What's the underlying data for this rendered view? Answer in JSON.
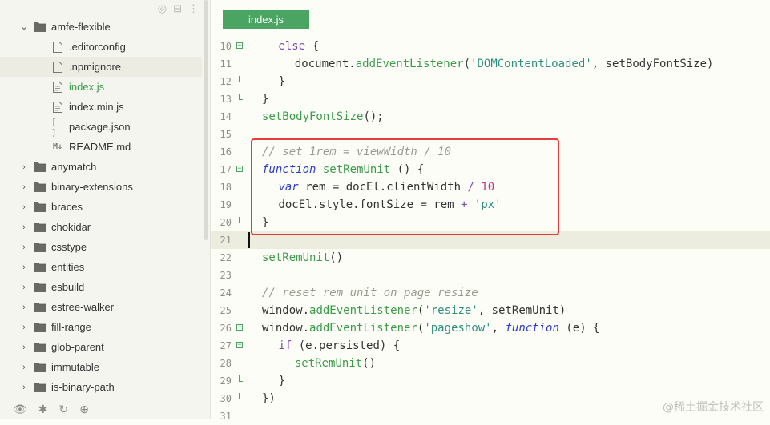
{
  "sidebar": {
    "tree": [
      {
        "type": "folder",
        "open": true,
        "depth": 1,
        "label": "amfe-flexible"
      },
      {
        "type": "file",
        "icon": "file",
        "depth": 2,
        "label": ".editorconfig"
      },
      {
        "type": "file",
        "icon": "file",
        "depth": 2,
        "label": ".npmignore",
        "selected": true
      },
      {
        "type": "file",
        "icon": "js",
        "depth": 2,
        "label": "index.js",
        "active": true
      },
      {
        "type": "file",
        "icon": "js",
        "depth": 2,
        "label": "index.min.js"
      },
      {
        "type": "file",
        "icon": "json",
        "depth": 2,
        "label": "package.json"
      },
      {
        "type": "file",
        "icon": "md",
        "depth": 2,
        "label": "README.md"
      },
      {
        "type": "folder",
        "open": false,
        "depth": 1,
        "label": "anymatch"
      },
      {
        "type": "folder",
        "open": false,
        "depth": 1,
        "label": "binary-extensions"
      },
      {
        "type": "folder",
        "open": false,
        "depth": 1,
        "label": "braces"
      },
      {
        "type": "folder",
        "open": false,
        "depth": 1,
        "label": "chokidar"
      },
      {
        "type": "folder",
        "open": false,
        "depth": 1,
        "label": "csstype"
      },
      {
        "type": "folder",
        "open": false,
        "depth": 1,
        "label": "entities"
      },
      {
        "type": "folder",
        "open": false,
        "depth": 1,
        "label": "esbuild"
      },
      {
        "type": "folder",
        "open": false,
        "depth": 1,
        "label": "estree-walker"
      },
      {
        "type": "folder",
        "open": false,
        "depth": 1,
        "label": "fill-range"
      },
      {
        "type": "folder",
        "open": false,
        "depth": 1,
        "label": "glob-parent"
      },
      {
        "type": "folder",
        "open": false,
        "depth": 1,
        "label": "immutable"
      },
      {
        "type": "folder",
        "open": false,
        "depth": 1,
        "label": "is-binary-path"
      }
    ],
    "toolbar_icons": [
      "target-icon",
      "collapse-icon",
      "more-icon"
    ],
    "bottom_icons": [
      "eye-icon",
      "bug-icon",
      "refresh-icon",
      "globe-icon"
    ]
  },
  "editor": {
    "tab_label": "index.js",
    "lines": [
      {
        "n": "10",
        "fold": "close",
        "indent": 1,
        "parts": [
          [
            "kw",
            "else"
          ],
          [
            "",
            "{"
          ]
        ]
      },
      {
        "n": "11",
        "indent": 2,
        "parts": [
          [
            "",
            "document."
          ],
          [
            "fn",
            "addEventListener"
          ],
          [
            "",
            "("
          ],
          [
            "str",
            "'DOMContentLoaded'"
          ],
          [
            "",
            ", setBodyFontSize)"
          ]
        ]
      },
      {
        "n": "12",
        "fold": "end",
        "indent": 1,
        "parts": [
          [
            "",
            "}"
          ]
        ]
      },
      {
        "n": "13",
        "fold": "end",
        "indent": 0,
        "parts": [
          [
            "",
            "}"
          ]
        ]
      },
      {
        "n": "14",
        "indent": 0,
        "parts": [
          [
            "fn",
            "setBodyFontSize"
          ],
          [
            "",
            "();"
          ]
        ]
      },
      {
        "n": "15",
        "indent": 0,
        "parts": []
      },
      {
        "n": "16",
        "indent": 0,
        "parts": [
          [
            "cmt",
            "// set 1rem = viewWidth / 10"
          ]
        ]
      },
      {
        "n": "17",
        "fold": "open",
        "indent": 0,
        "parts": [
          [
            "kwb",
            "function"
          ],
          [
            "",
            " "
          ],
          [
            "fn",
            "setRemUnit"
          ],
          [
            "",
            " () {"
          ]
        ]
      },
      {
        "n": "18",
        "indent": 1,
        "parts": [
          [
            "kwb",
            "var"
          ],
          [
            "",
            " rem = docEl.clientWidth "
          ],
          [
            "op",
            "/"
          ],
          [
            "",
            " "
          ],
          [
            "num",
            "10"
          ]
        ]
      },
      {
        "n": "19",
        "indent": 1,
        "parts": [
          [
            "",
            "docEl.style.fontSize = rem "
          ],
          [
            "op",
            "+"
          ],
          [
            "",
            " "
          ],
          [
            "str",
            "'px'"
          ]
        ]
      },
      {
        "n": "20",
        "fold": "end",
        "indent": 0,
        "parts": [
          [
            "",
            "}"
          ]
        ]
      },
      {
        "n": "21",
        "indent": 0,
        "current": true,
        "parts": []
      },
      {
        "n": "22",
        "indent": 0,
        "parts": [
          [
            "fn",
            "setRemUnit"
          ],
          [
            "",
            "()"
          ]
        ]
      },
      {
        "n": "23",
        "indent": 0,
        "parts": []
      },
      {
        "n": "24",
        "indent": 0,
        "parts": [
          [
            "cmt",
            "// reset rem unit on page resize"
          ]
        ]
      },
      {
        "n": "25",
        "indent": 0,
        "parts": [
          [
            "",
            "window."
          ],
          [
            "fn",
            "addEventListener"
          ],
          [
            "",
            "("
          ],
          [
            "str",
            "'resize'"
          ],
          [
            "",
            ", setRemUnit)"
          ]
        ]
      },
      {
        "n": "26",
        "fold": "open",
        "indent": 0,
        "parts": [
          [
            "",
            "window."
          ],
          [
            "fn",
            "addEventListener"
          ],
          [
            "",
            "("
          ],
          [
            "str",
            "'pageshow'"
          ],
          [
            "",
            ", "
          ],
          [
            "kwb",
            "function"
          ],
          [
            "",
            " (e) {"
          ]
        ]
      },
      {
        "n": "27",
        "fold": "open",
        "indent": 1,
        "parts": [
          [
            "kw",
            "if"
          ],
          [
            "",
            " (e.persisted) {"
          ]
        ]
      },
      {
        "n": "28",
        "indent": 2,
        "parts": [
          [
            "fn",
            "setRemUnit"
          ],
          [
            "",
            "()"
          ]
        ]
      },
      {
        "n": "29",
        "fold": "end",
        "indent": 1,
        "parts": [
          [
            "",
            "}"
          ]
        ]
      },
      {
        "n": "30",
        "fold": "end",
        "indent": 0,
        "parts": [
          [
            "",
            "})"
          ]
        ]
      },
      {
        "n": "31",
        "indent": 0,
        "parts": []
      }
    ]
  },
  "watermark": "@稀土掘金技术社区",
  "colors": {
    "accent": "#4aa563",
    "highlight_box": "#e83a3a"
  }
}
